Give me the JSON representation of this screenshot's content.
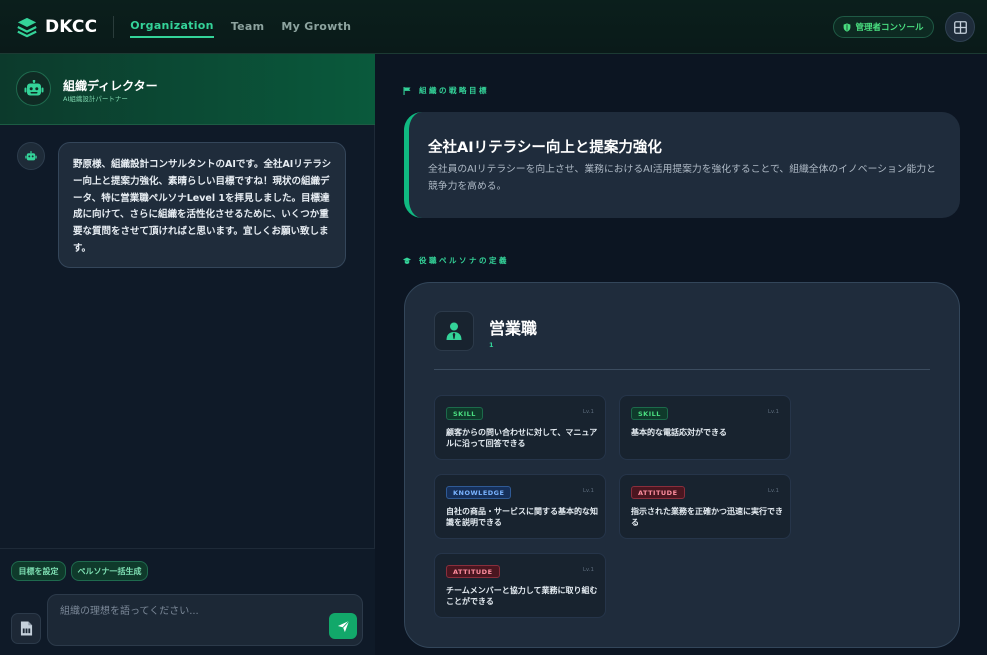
{
  "header": {
    "logo_text": "DKCC",
    "tabs": [
      {
        "label": "Organization",
        "active": true
      },
      {
        "label": "Team",
        "active": false
      },
      {
        "label": "My Growth",
        "active": false
      }
    ],
    "admin_console_label": "管理者コンソール",
    "icons": {
      "logo": "layers-icon",
      "admin": "shield-icon",
      "apps": "grid-icon"
    }
  },
  "colors": {
    "accent": "#34d399",
    "skill": "#4ade80",
    "knowledge": "#7ab3ff",
    "attitude": "#ff8f9f"
  },
  "chat": {
    "bot_name": "組織ディレクター",
    "bot_subtitle": "AI組織設計パートナー",
    "messages": [
      {
        "sender": "bot",
        "text": "野原様、組織設計コンサルタントのAIです。全社AIリテラシー向上と提案力強化、素晴らしい目標ですね！現状の組織データ、特に営業職ペルソナLevel 1を拝見しました。目標達成に向けて、さらに組織を活性化させるために、いくつか重要な質問をさせて頂ければと思います。宜しくお願い致します。"
      }
    ],
    "quick_actions": [
      "目標を設定",
      "ペルソナ一括生成"
    ],
    "input_placeholder": "組織の理想を語ってください...",
    "icons": {
      "avatar": "robot-icon",
      "attach": "pdf-file-icon",
      "send": "send-icon"
    }
  },
  "main": {
    "goal_section_label": "組織の戦略目標",
    "goal": {
      "title": "全社AIリテラシー向上と提案力強化",
      "description": "全社員のAIリテラシーを向上させ、業務におけるAI活用提案力を強化することで、組織全体のイノベーション能力と競争力を高める。"
    },
    "persona_section_label": "役職ペルソナの定義",
    "persona": {
      "name": "営業職",
      "level": "1",
      "competencies": [
        {
          "type": "SKILL",
          "level": "Lv.1",
          "text": "顧客からの問い合わせに対して、マニュアルに沿って回答できる"
        },
        {
          "type": "SKILL",
          "level": "Lv.1",
          "text": "基本的な電話応対ができる"
        },
        {
          "type": "KNOWLEDGE",
          "level": "Lv.1",
          "text": "自社の商品・サービスに関する基本的な知識を説明できる"
        },
        {
          "type": "ATTITUDE",
          "level": "Lv.1",
          "text": "指示された業務を正確かつ迅速に実行できる"
        },
        {
          "type": "ATTITUDE",
          "level": "Lv.1",
          "text": "チームメンバーと協力して業務に取り組むことができる"
        }
      ]
    }
  }
}
